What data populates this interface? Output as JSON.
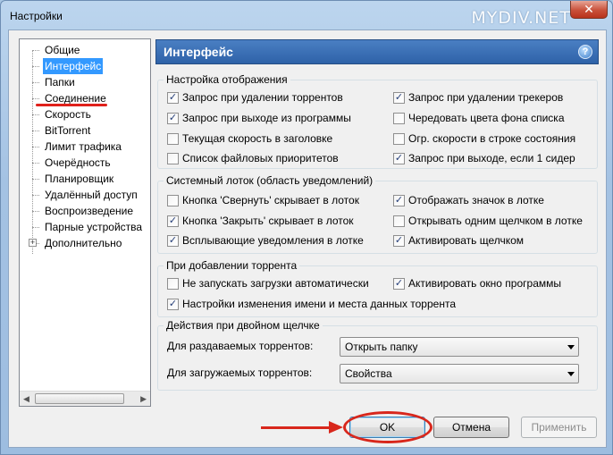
{
  "window": {
    "title": "Настройки",
    "watermark": "MYDIV.NET",
    "close_label": "✕"
  },
  "tree": {
    "items": [
      {
        "label": "Общие",
        "selected": false
      },
      {
        "label": "Интерфейс",
        "selected": true
      },
      {
        "label": "Папки",
        "selected": false
      },
      {
        "label": "Соединение",
        "selected": false
      },
      {
        "label": "Скорость",
        "selected": false
      },
      {
        "label": "BitTorrent",
        "selected": false
      },
      {
        "label": "Лимит трафика",
        "selected": false
      },
      {
        "label": "Очерёдность",
        "selected": false
      },
      {
        "label": "Планировщик",
        "selected": false
      },
      {
        "label": "Удалённый доступ",
        "selected": false
      },
      {
        "label": "Воспроизведение",
        "selected": false
      },
      {
        "label": "Парные устройства",
        "selected": false
      },
      {
        "label": "Дополнительно",
        "selected": false,
        "expandable": true
      }
    ]
  },
  "header": {
    "title": "Интерфейс",
    "help_label": "?"
  },
  "groups": {
    "display": {
      "title": "Настройка отображения",
      "options": [
        {
          "label": "Запрос при удалении торрентов",
          "checked": true
        },
        {
          "label": "Запрос при выходе из программы",
          "checked": true
        },
        {
          "label": "Текущая скорость в заголовке",
          "checked": false
        },
        {
          "label": "Список файловых приоритетов",
          "checked": false
        },
        {
          "label": "Запрос при удалении трекеров",
          "checked": true
        },
        {
          "label": "Чередовать цвета фона списка",
          "checked": false
        },
        {
          "label": "Огр. скорости в строке состояния",
          "checked": false
        },
        {
          "label": "Запрос при выходе, если 1 сидер",
          "checked": true
        }
      ]
    },
    "tray": {
      "title": "Системный лоток (область уведомлений)",
      "options": [
        {
          "label": "Кнопка 'Свернуть' скрывает в лоток",
          "checked": false
        },
        {
          "label": "Кнопка 'Закрыть' скрывает в лоток",
          "checked": true
        },
        {
          "label": "Всплывающие уведомления в лотке",
          "checked": true
        },
        {
          "label": "Отображать значок в лотке",
          "checked": true
        },
        {
          "label": "Открывать одним щелчком в лотке",
          "checked": false
        },
        {
          "label": "Активировать щелчком",
          "checked": true
        }
      ]
    },
    "adding": {
      "title": "При добавлении торрента",
      "options": [
        {
          "label": "Не запускать загрузки автоматически",
          "checked": false
        },
        {
          "label": "Активировать окно программы",
          "checked": true
        },
        {
          "label": "Настройки изменения имени и места данных торрента",
          "checked": true
        }
      ]
    },
    "double_click": {
      "title": "Действия при двойном щелчке",
      "seeding_label": "Для раздаваемых торрентов:",
      "seeding_value": "Открыть папку",
      "downloading_label": "Для загружаемых торрентов:",
      "downloading_value": "Свойства"
    }
  },
  "buttons": {
    "ok": "OK",
    "cancel": "Отмена",
    "apply": "Применить"
  },
  "accent_colors": {
    "annotation": "#d8271c",
    "header": "#2e62a8",
    "selection": "#3399ff"
  }
}
